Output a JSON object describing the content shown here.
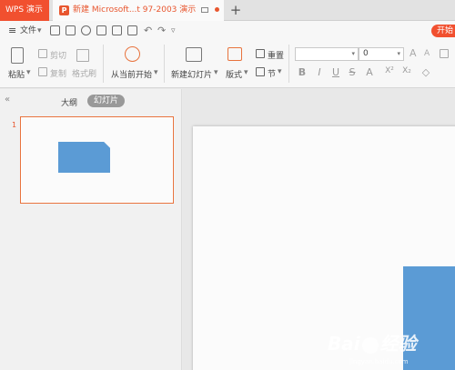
{
  "tabs": {
    "app_label": "WPS 演示",
    "doc_label": "新建 Microsoft...t 97-2003 演示",
    "new_tab": "+"
  },
  "menu": {
    "hamburger": "≡",
    "file_label": "文件",
    "file_arrow": "▾",
    "start_label": "开始"
  },
  "ribbon": {
    "paste_label": "粘贴",
    "cut_label": "剪切",
    "copy_label": "复制",
    "format_painter_label": "格式刷",
    "from_current_label": "从当前开始",
    "new_slide_label": "新建幻灯片",
    "layout_label": "版式",
    "reset_label": "重置",
    "section_label": "节",
    "font_size_value": "0",
    "format_buttons": [
      "B",
      "I",
      "U",
      "S",
      "A",
      "X²",
      "X₂",
      "◇"
    ]
  },
  "left_panel": {
    "collapse": "«",
    "outline_tab": "大纲",
    "slides_tab": "幻灯片",
    "slide_number": "1"
  },
  "watermark": {
    "text_left": "Bai",
    "text_right": "经验",
    "sub": "jingyan.baidu.com"
  },
  "colors": {
    "brand": "#f1502f",
    "shape_fill": "#5b9bd5",
    "selection": "#e8733d"
  }
}
